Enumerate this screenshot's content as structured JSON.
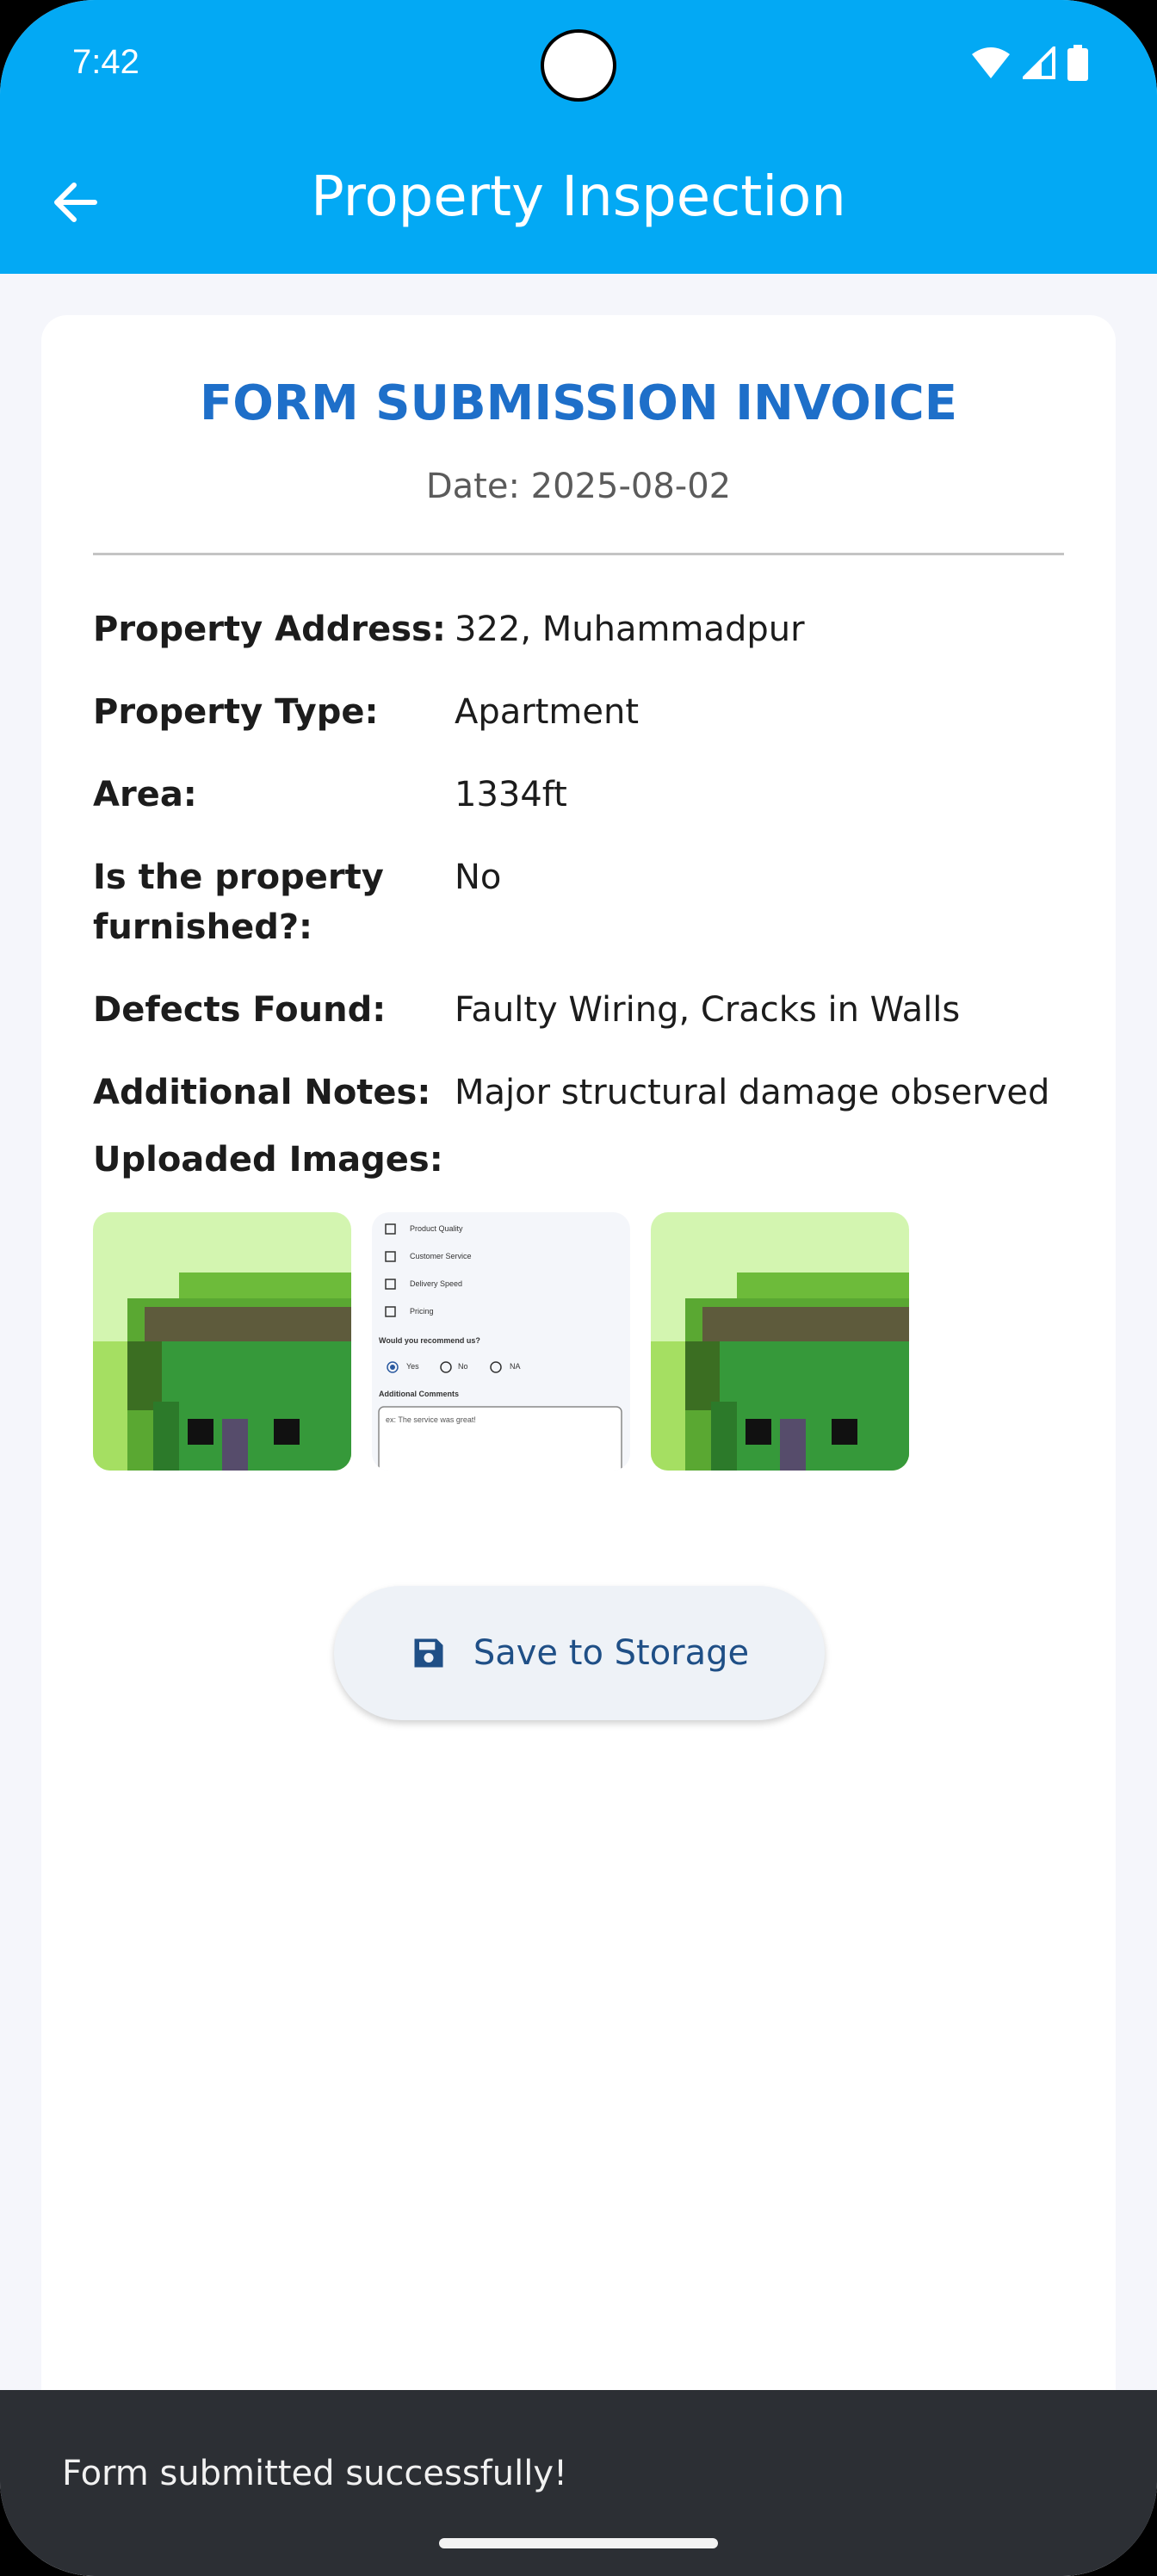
{
  "status_bar": {
    "time": "7:42"
  },
  "app_bar": {
    "title": "Property Inspection"
  },
  "invoice": {
    "title": "FORM SUBMISSION INVOICE",
    "date": "Date: 2025-08-02",
    "fields": [
      {
        "label": "Property Address:",
        "value": "322, Muhammadpur"
      },
      {
        "label": "Property Type:",
        "value": "Apartment"
      },
      {
        "label": "Area:",
        "value": "1334ft"
      },
      {
        "label": "Is the property furnished?:",
        "value": "No"
      },
      {
        "label": "Defects Found:",
        "value": "Faulty Wiring, Cracks in Walls"
      },
      {
        "label": "Additional Notes:",
        "value": "Major structural damage observed"
      }
    ],
    "images_label": "Uploaded Images:",
    "form_thumb": {
      "checkbox_items": [
        "Product Quality",
        "Customer Service",
        "Delivery Speed",
        "Pricing"
      ],
      "question": "Would you recommend us?",
      "options": [
        "Yes",
        "No",
        "NA"
      ],
      "comments_label": "Additional Comments",
      "comments_placeholder": "ex: The service was great!"
    }
  },
  "save_button": {
    "label": "Save to Storage"
  },
  "snackbar": {
    "message": "Form submitted successfully!"
  }
}
